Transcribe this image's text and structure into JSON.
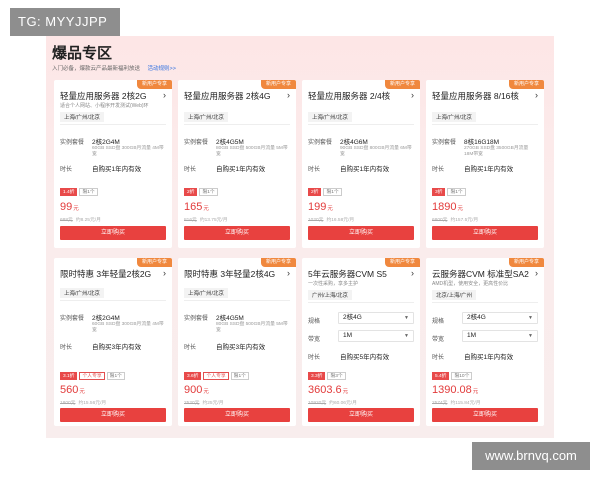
{
  "watermarks": {
    "top_left": "TG: MYYJJPP",
    "bottom_right": "www.brnvq.com"
  },
  "panel": {
    "title": "爆品专区",
    "subtitle": "入门必备，爆款云产品最新福利放送",
    "link": "活动规则>>"
  },
  "cards": [
    {
      "badge": "新用户专享",
      "title": "轻量应用服务器 2核2G",
      "desc": "适合个人网站、小程序开发测试(Web)环",
      "region": "上海/广州/北京",
      "row1_label": "实例套餐",
      "row1_value": "2核2G4M",
      "spec": "60GB SSD盘 300GB月流量 4M带宽",
      "row2_label": "时长",
      "row2_value": "自购买1年内有效",
      "tags": [
        "1.4折",
        "限1个"
      ],
      "price": "99",
      "unit": "元",
      "orig_price": "688元",
      "orig_note": "约8.25元/月",
      "buy": "立即购买"
    },
    {
      "badge": "新用户专享",
      "title": "轻量应用服务器 2核4G",
      "desc": "",
      "region": "上海/广州/北京",
      "row1_label": "实例套餐",
      "row1_value": "2核4G5M",
      "spec": "80GB SSD盘 500GB月流量 5M带宽",
      "row2_label": "时长",
      "row2_value": "自购买1年内有效",
      "tags": [
        "2折",
        "限1个"
      ],
      "price": "165",
      "unit": "元",
      "orig_price": "816元",
      "orig_note": "约13.75元/月",
      "buy": "立即购买"
    },
    {
      "badge": "新用户专享",
      "title": "轻量应用服务器 2/4核",
      "desc": "",
      "region": "上海/广州/北京",
      "row1_label": "实例套餐",
      "row1_value": "2核4G6M",
      "spec": "90GB SSD盘 800GB月流量 6M带宽",
      "row2_label": "时长",
      "row2_value": "自购买1年内有效",
      "tags": [
        "2折",
        "限1个"
      ],
      "price": "199",
      "unit": "元",
      "orig_price": "1020元",
      "orig_note": "约16.58元/月",
      "buy": "立即购买"
    },
    {
      "badge": "新用户专享",
      "title": "轻量应用服务器 8/16核",
      "desc": "",
      "region": "上海/广州/北京",
      "row1_label": "实例套餐",
      "row1_value": "8核16G18M",
      "spec": "270GB SSD盘 3500GB月流量 18M带宽",
      "row2_label": "时长",
      "row2_value": "自购买1年内有效",
      "tags": [
        "3折",
        "限1个"
      ],
      "price": "1890",
      "unit": "元",
      "orig_price": "6800元",
      "orig_note": "约157.5元/月",
      "buy": "立即购买"
    },
    {
      "badge": "新用户专享",
      "title": "限时特惠 3年轻量2核2G",
      "desc": "",
      "region": "上海/广州/北京",
      "row1_label": "实例套餐",
      "row1_value": "2核2G4M",
      "spec": "60GB SSD盘 300GB月流量 4M带宽",
      "row2_label": "时长",
      "row2_value": "自购买3年内有效",
      "tags": [
        "3.1折",
        "个人专享",
        "限1个"
      ],
      "price": "560",
      "unit": "元",
      "orig_price": "1800元",
      "orig_note": "约15.56元/月",
      "buy": "立即购买"
    },
    {
      "badge": "新用户专享",
      "title": "限时特惠 3年轻量2核4G",
      "desc": "",
      "region": "上海/广州/北京",
      "row1_label": "实例套餐",
      "row1_value": "2核4G5M",
      "spec": "80GB SSD盘 500GB月流量 5M带宽",
      "row2_label": "时长",
      "row2_value": "自购买3年内有效",
      "tags": [
        "3.6折",
        "个人专享",
        "限1个"
      ],
      "price": "900",
      "unit": "元",
      "orig_price": "2520元",
      "orig_note": "约25元/月",
      "buy": "立即购买"
    },
    {
      "badge": "新用户专享",
      "title": "5年云服务器CVM S5",
      "desc": "一次性采购，享多主护",
      "region": "广州/上海/北京",
      "row1_label": "规格",
      "row1_value": "2核4G",
      "row2_label": "带宽",
      "row2_value": "1M",
      "row3_label": "时长",
      "row3_value": "自购买5年内有效",
      "tags": [
        "3.3折",
        "限3个"
      ],
      "price": "3603.6",
      "unit": "元",
      "orig_price": "10920元",
      "orig_note": "约60.06元/月",
      "buy": "立即购买"
    },
    {
      "badge": "新用户专享",
      "title": "云服务器CVM 标准型SA2",
      "desc": "AMD机型，使用安全，更高性价比",
      "region": "北京/上海/广州",
      "row1_label": "规格",
      "row1_value": "2核4G",
      "row2_label": "带宽",
      "row2_value": "1M",
      "row3_label": "时长",
      "row3_value": "自购买1年内有效",
      "tags": [
        "5.4折",
        "限10个"
      ],
      "price": "1390.08",
      "unit": "元",
      "orig_price": "2574元",
      "orig_note": "约115.84元/月",
      "buy": "立即购买"
    }
  ]
}
